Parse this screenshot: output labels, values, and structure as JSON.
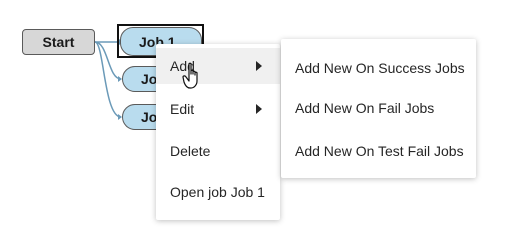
{
  "workflow": {
    "start_label": "Start",
    "jobs": [
      "Job 1",
      "Job 2",
      "Job 3"
    ]
  },
  "context_menu": {
    "items": [
      {
        "label": "Add",
        "has_submenu": true,
        "hovered": true
      },
      {
        "label": "Edit",
        "has_submenu": true
      },
      {
        "label": "Delete"
      },
      {
        "label": "Open job Job 1"
      }
    ]
  },
  "submenu": {
    "items": [
      {
        "label": "Add New On Success Jobs"
      },
      {
        "label": "Add New On Fail Jobs"
      },
      {
        "label": "Add New On Test Fail Jobs"
      }
    ]
  },
  "colors": {
    "start_fill": "#d7d7d7",
    "job_fill": "#b9dcee",
    "connector": "#6b9ab8"
  }
}
